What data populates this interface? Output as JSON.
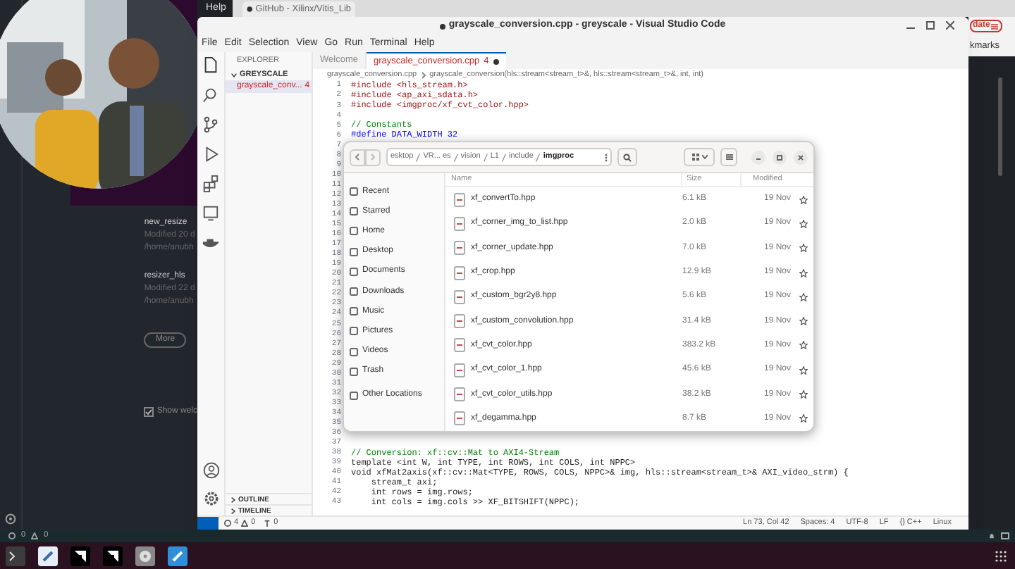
{
  "background_app": {
    "menu_item": "Help",
    "recent": [
      {
        "name": "new_resize",
        "modified": "Modified 20 d",
        "path": "/home/anubh"
      },
      {
        "name": "resizer_hls",
        "modified": "Modified 22 d",
        "path": "/home/anubh"
      }
    ],
    "more_button": "More",
    "show_welcome": {
      "label": "Show welc",
      "checked": true
    },
    "status": {
      "errors": "0",
      "warnings": "0"
    }
  },
  "browser": {
    "tab_title": "GitHub - Xilinx/Vitis_Lib",
    "update_button": "date",
    "bookmarks": "kmarks"
  },
  "webcam": {
    "kind": "picture"
  },
  "window": {
    "title": "grayscale_conversion.cpp - greyscale - Visual Studio Code",
    "modified": true
  },
  "menu": [
    "File",
    "Edit",
    "Selection",
    "View",
    "Go",
    "Run",
    "Terminal",
    "Help"
  ],
  "explorer": {
    "title": "EXPLORER",
    "folder": "GREYSCALE",
    "files": [
      {
        "name": "grayscale_conv...",
        "problems": "4",
        "selected": true
      }
    ],
    "sections": [
      "OUTLINE",
      "TIMELINE"
    ]
  },
  "tabs": [
    {
      "label": "Welcome",
      "selected": false
    },
    {
      "label": "grayscale_conversion.cpp",
      "problems": "4",
      "selected": true,
      "modified": true
    }
  ],
  "breadcrumb": [
    "grayscale_conversion.cpp",
    "grayscale_conversion(hls::stream<stream_t>&, hls::stream<stream_t>&, int, int)"
  ],
  "code": [
    {
      "n": "1",
      "kind": "directive",
      "text": "#include <hls_stream.h>"
    },
    {
      "n": "2",
      "kind": "directive",
      "text": "#include <ap_axi_sdata.h>"
    },
    {
      "n": "3",
      "kind": "directive",
      "text": "#include <imgproc/xf_cvt_color.hpp>"
    },
    {
      "n": "4"
    },
    {
      "n": "5",
      "kind": "comment",
      "text": "// Constants"
    },
    {
      "n": "6",
      "kind": "define",
      "text": "#define DATA_WIDTH 32"
    },
    {
      "n": "7"
    },
    {
      "n": "8"
    },
    {
      "n": "9"
    },
    {
      "n": "10"
    },
    {
      "n": "11"
    },
    {
      "n": "12"
    },
    {
      "n": "13"
    },
    {
      "n": "14"
    },
    {
      "n": "15"
    },
    {
      "n": "16"
    },
    {
      "n": "17"
    },
    {
      "n": "18"
    },
    {
      "n": "19"
    },
    {
      "n": "20"
    },
    {
      "n": "21"
    },
    {
      "n": "22"
    },
    {
      "n": "23"
    },
    {
      "n": "24"
    },
    {
      "n": "25"
    },
    {
      "n": "26"
    },
    {
      "n": "27"
    },
    {
      "n": "28"
    },
    {
      "n": "29"
    },
    {
      "n": "30"
    },
    {
      "n": "31"
    },
    {
      "n": "32"
    },
    {
      "n": "33"
    },
    {
      "n": "34"
    },
    {
      "n": "35"
    },
    {
      "n": "36"
    },
    {
      "n": "37"
    },
    {
      "n": "38",
      "kind": "comment",
      "text": "// Conversion: xf::cv::Mat to AXI4-Stream"
    },
    {
      "n": "39",
      "kind": "code",
      "text": "template <int W, int TYPE, int ROWS, int COLS, int NPPC>"
    },
    {
      "n": "40",
      "kind": "code",
      "text": "void xfMat2axis(xf::cv::Mat<TYPE, ROWS, COLS, NPPC>& img, hls::stream<stream_t>& AXI_video_strm) {"
    },
    {
      "n": "41",
      "kind": "code",
      "text": "    stream_t axi;"
    },
    {
      "n": "42",
      "kind": "code",
      "text": "    int rows = img.rows;"
    },
    {
      "n": "43",
      "kind": "code",
      "text": "    int cols = img.cols >> XF_BITSHIFT(NPPC);"
    }
  ],
  "status_bar": {
    "errors": "4",
    "warnings": "0",
    "ports": "0",
    "items": [
      "Ln 73, Col 42",
      "Spaces: 4",
      "UTF-8",
      "LF",
      "{} C++",
      "Linux"
    ]
  },
  "file_dialog": {
    "path": [
      {
        "label": "esktop",
        "selected": false
      },
      {
        "label": "VR... es",
        "selected": false
      },
      {
        "label": "vision",
        "selected": false
      },
      {
        "label": "L1",
        "selected": false
      },
      {
        "label": "include",
        "selected": false
      },
      {
        "label": "imgproc",
        "selected": true
      }
    ],
    "places": [
      "Recent",
      "Starred",
      "Home",
      "Desktop",
      "Documents",
      "Downloads",
      "Music",
      "Pictures",
      "Videos",
      "Trash",
      "Other Locations"
    ],
    "columns": [
      "Name",
      "Size",
      "Modified"
    ],
    "files": [
      {
        "name": "xf_convertTo.hpp",
        "size": "6.1 kB",
        "modified": "19 Nov"
      },
      {
        "name": "xf_corner_img_to_list.hpp",
        "size": "2.0 kB",
        "modified": "19 Nov"
      },
      {
        "name": "xf_corner_update.hpp",
        "size": "7.0 kB",
        "modified": "19 Nov"
      },
      {
        "name": "xf_crop.hpp",
        "size": "12.9 kB",
        "modified": "19 Nov"
      },
      {
        "name": "xf_custom_bgr2y8.hpp",
        "size": "5.6 kB",
        "modified": "19 Nov"
      },
      {
        "name": "xf_custom_convolution.hpp",
        "size": "31.4 kB",
        "modified": "19 Nov"
      },
      {
        "name": "xf_cvt_color.hpp",
        "size": "383.2 kB",
        "modified": "19 Nov"
      },
      {
        "name": "xf_cvt_color_1.hpp",
        "size": "45.6 kB",
        "modified": "19 Nov"
      },
      {
        "name": "xf_cvt_color_utils.hpp",
        "size": "38.2 kB",
        "modified": "19 Nov"
      },
      {
        "name": "xf_degamma.hpp",
        "size": "8.7 kB",
        "modified": "19 Nov"
      }
    ]
  }
}
